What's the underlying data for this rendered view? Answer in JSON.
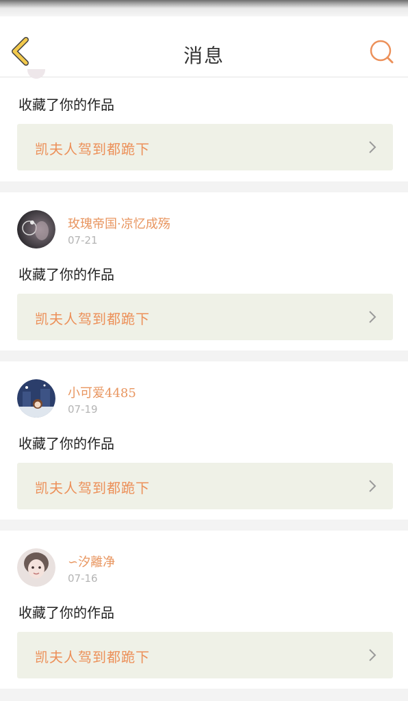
{
  "header": {
    "title": "消息",
    "back_icon": "chevron-left-icon",
    "search_icon": "search-icon"
  },
  "colors": {
    "accent": "#ec9059",
    "back_icon": "#f2c94c",
    "card_bg": "#eff1e7",
    "page_bg": "#f3f3f3"
  },
  "notifications": [
    {
      "action": "收藏了你的作品",
      "work": "凯夫人驾到都跪下"
    },
    {
      "user": "玫瑰帝国·凉忆成殇",
      "date": "07-21",
      "action": "收藏了你的作品",
      "work": "凯夫人驾到都跪下"
    },
    {
      "user": "小可爱4485",
      "date": "07-19",
      "action": "收藏了你的作品",
      "work": "凯夫人驾到都跪下"
    },
    {
      "user": "∽汐離净",
      "date": "07-16",
      "action": "收藏了你的作品",
      "work": "凯夫人驾到都跪下"
    }
  ]
}
